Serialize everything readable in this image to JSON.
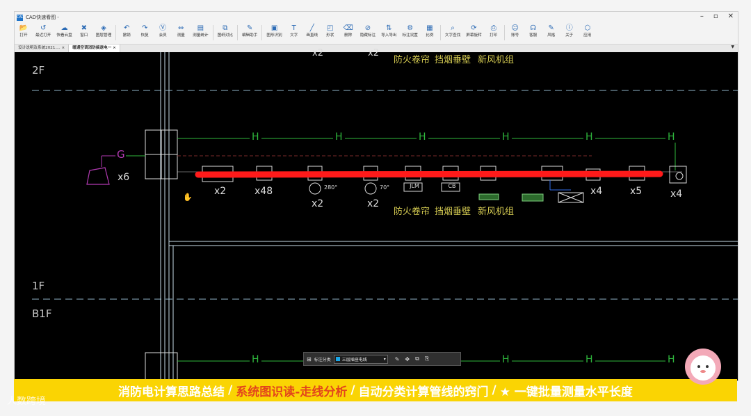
{
  "window": {
    "title": "CAD快速看图 -",
    "buttons": [
      "–",
      "▫",
      "✕"
    ]
  },
  "toolbar": {
    "items": [
      {
        "label": "打开",
        "icon": "folder-icon",
        "glyph": "📂"
      },
      {
        "label": "最近打开",
        "icon": "history-icon",
        "glyph": "↺"
      },
      {
        "label": "快看云盘",
        "icon": "cloud-icon",
        "glyph": "☁"
      },
      {
        "label": "窗口",
        "icon": "window-icon",
        "glyph": "✖"
      },
      {
        "label": "图层管理",
        "icon": "layers-icon",
        "glyph": "◈"
      },
      {
        "sep": true
      },
      {
        "label": "撤销",
        "icon": "undo-icon",
        "glyph": "↶"
      },
      {
        "label": "恢复",
        "icon": "redo-icon",
        "glyph": "↷"
      },
      {
        "label": "会员",
        "icon": "vip-icon",
        "glyph": "Ⓥ"
      },
      {
        "label": "测量",
        "icon": "measure-icon",
        "glyph": "⇔"
      },
      {
        "label": "测量统计",
        "icon": "measure-stats-icon",
        "glyph": "▤"
      },
      {
        "sep": true
      },
      {
        "label": "图纸对比",
        "icon": "compare-icon",
        "glyph": "⧉"
      },
      {
        "sep": true
      },
      {
        "label": "编辑助手",
        "icon": "edit-helper-icon",
        "glyph": "✎"
      },
      {
        "sep": true
      },
      {
        "label": "图形识别",
        "icon": "shape-recognize-icon",
        "glyph": "▣"
      },
      {
        "label": "文字",
        "icon": "text-icon",
        "glyph": "T"
      },
      {
        "label": "画直线",
        "icon": "line-icon",
        "glyph": "╱"
      },
      {
        "label": "形状",
        "icon": "shape-icon",
        "glyph": "◰"
      },
      {
        "label": "删除",
        "icon": "eraser-icon",
        "glyph": "⌫"
      },
      {
        "label": "隐藏标注",
        "icon": "hide-annotation-icon",
        "glyph": "⊘"
      },
      {
        "label": "导入导出",
        "icon": "import-export-icon",
        "glyph": "⇅"
      },
      {
        "label": "标注设置",
        "icon": "annotation-settings-icon",
        "glyph": "⚙"
      },
      {
        "label": "比例",
        "icon": "scale-icon",
        "glyph": "▦"
      },
      {
        "sep": true
      },
      {
        "label": "文字查找",
        "icon": "text-search-icon",
        "glyph": "⌕"
      },
      {
        "label": "屏幕旋转",
        "icon": "rotate-icon",
        "glyph": "⟳"
      },
      {
        "label": "打印",
        "icon": "print-icon",
        "glyph": "⎙"
      },
      {
        "sep": true
      },
      {
        "label": "账号",
        "icon": "account-icon",
        "glyph": "☺"
      },
      {
        "label": "客服",
        "icon": "headset-icon",
        "glyph": "☊"
      },
      {
        "label": "风格",
        "icon": "style-icon",
        "glyph": "✎"
      },
      {
        "label": "关于",
        "icon": "info-icon",
        "glyph": "ⓘ"
      },
      {
        "label": "应用",
        "icon": "apps-icon",
        "glyph": "⬡"
      }
    ]
  },
  "tabs": [
    {
      "label": "设计说明及系统2021.… ×",
      "active": false
    },
    {
      "label": "暖通空调消防搞速电一 ×",
      "active": true
    }
  ],
  "drawing": {
    "floors": {
      "f2": "2F",
      "f1": "1F",
      "b1": "B1F"
    },
    "top_row_labels": {
      "x2a": "x2",
      "x2b": "x2",
      "fire_curtain": "防火卷帘",
      "smoke_wall": "挡烟垂壁",
      "fresh_air": "新风机组"
    },
    "pipe_letters": {
      "g": "G",
      "h": "H"
    },
    "speaker_count": "x6",
    "device_counts": [
      "x2",
      "x48",
      "x2",
      "x2",
      "x4",
      "x5",
      "x4"
    ],
    "valve_temps": [
      "280°",
      "70°"
    ],
    "box_labels": [
      "JLM",
      "CB"
    ],
    "row_names": [
      "防火卷帘",
      "挡烟垂壁",
      "新风机组"
    ],
    "colors": {
      "highlight": "#ff1a1a",
      "pipe": "#2fb83d",
      "symbol": "#dcdcdc",
      "label": "#d6cc52",
      "speaker": "#b23ab2",
      "dashed": "#7a2a2a"
    }
  },
  "float_toolbar": {
    "label": "标注分类",
    "select": "三层插座电线",
    "icon_names": [
      "grid-icon",
      "edit-icon",
      "move-icon",
      "copy-icon",
      "paste-icon"
    ]
  },
  "subtitle": {
    "part1": "消防电计算思路总结",
    "sep": "/",
    "part2": "系统图识读-走线分析",
    "part3": "自动分类计算管线的窍门",
    "part4": "★ 一键批量测量水平长度"
  },
  "watermark": "人数跨境"
}
